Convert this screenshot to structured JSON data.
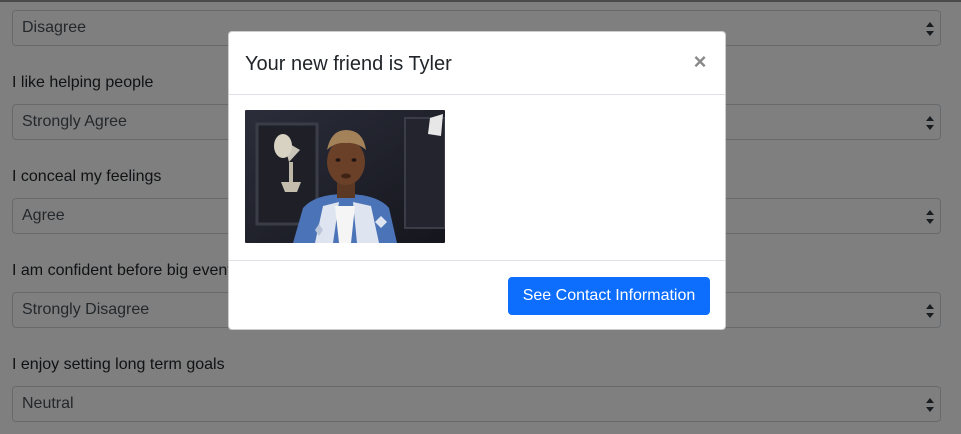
{
  "form": {
    "questions": [
      {
        "label": "",
        "selected": "Disagree"
      },
      {
        "label": "I like helping people",
        "selected": "Strongly Agree"
      },
      {
        "label": "I conceal my feelings",
        "selected": "Agree"
      },
      {
        "label": "I am confident before big events",
        "selected": "Strongly Disagree"
      },
      {
        "label": "I enjoy setting long term goals",
        "selected": "Neutral"
      }
    ]
  },
  "modal": {
    "title": "Your new friend is Tyler",
    "close_symbol": "×",
    "image_icon": "friend-gif-image",
    "button_label": "See Contact Information"
  },
  "colors": {
    "primary": "#0d6efd",
    "backdrop": "rgba(0,0,0,0.5)"
  }
}
